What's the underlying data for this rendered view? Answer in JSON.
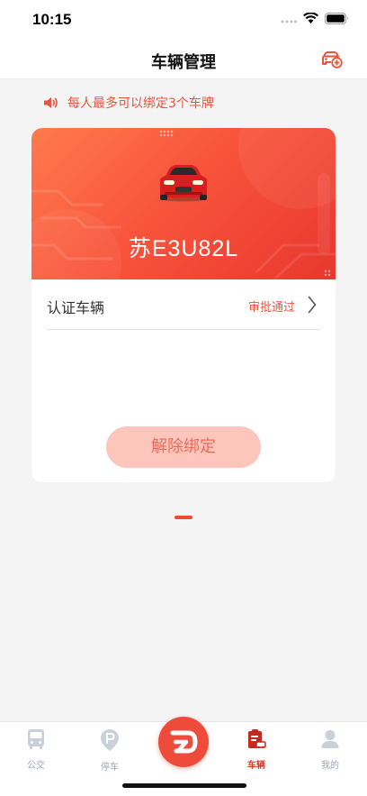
{
  "status_bar": {
    "time": "10:15"
  },
  "header": {
    "title": "车辆管理",
    "add_icon": "car-add-icon"
  },
  "notice": {
    "icon": "speaker-icon",
    "text": "每人最多可以绑定3个车牌"
  },
  "vehicle_card": {
    "car_icon": "red-car-icon",
    "plate_number": "苏E3U82L",
    "verify_row": {
      "label": "认证车辆",
      "status": "审批通过",
      "status_color": "#e8553e"
    },
    "unbind_button": "解除绑定"
  },
  "carousel": {
    "active_page": 1
  },
  "tab_bar": {
    "items": [
      {
        "label": "公交",
        "icon": "bus-icon",
        "active": false
      },
      {
        "label": "停车",
        "icon": "parking-icon",
        "active": false
      },
      {
        "label": "",
        "icon": "app-logo-icon",
        "active": false
      },
      {
        "label": "车辆",
        "icon": "vehicle-clipboard-icon",
        "active": true
      },
      {
        "label": "我的",
        "icon": "person-icon",
        "active": false
      }
    ]
  },
  "colors": {
    "accent": "#e8553e",
    "brand_red": "#ee4b3a",
    "inactive": "#9aa4b2"
  }
}
